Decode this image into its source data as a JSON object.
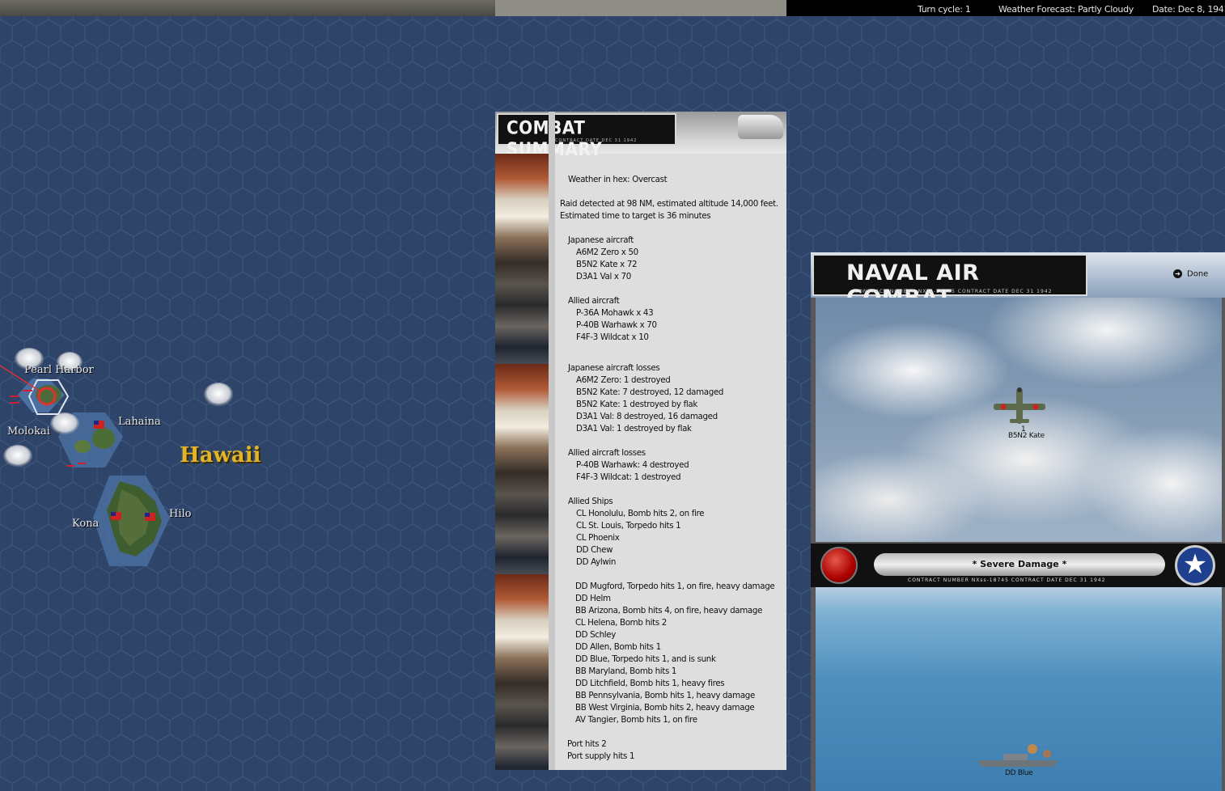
{
  "status": {
    "turn_cycle": "Turn cycle: 1",
    "weather": "Weather Forecast: Partly Cloudy",
    "date": "Date: Dec 8, 1941"
  },
  "map": {
    "region_label": "Hawaii",
    "places": [
      "Pearl Harbor",
      "Molokai",
      "Lahaina",
      "Kona",
      "Hilo"
    ]
  },
  "combat_summary": {
    "title": "COMBAT SUMMARY",
    "contract": "CONTRACT DATE DEC 31 1942",
    "lines": [
      "Weather in hex: Overcast",
      "Raid detected at 98 NM, estimated altitude 14,000 feet.",
      "Estimated time to target is 36 minutes",
      "Japanese aircraft",
      "A6M2 Zero x 50",
      "B5N2 Kate x 72",
      "D3A1 Val x 70",
      "Allied aircraft",
      "P-36A Mohawk x 43",
      "P-40B Warhawk x 70",
      "F4F-3 Wildcat x 10",
      "Japanese aircraft losses",
      "A6M2 Zero: 1 destroyed",
      "B5N2 Kate: 7 destroyed, 12 damaged",
      "B5N2 Kate: 1 destroyed by flak",
      "D3A1 Val: 8 destroyed, 16 damaged",
      "D3A1 Val: 1 destroyed by flak",
      "Allied aircraft losses",
      "P-40B Warhawk: 4 destroyed",
      "F4F-3 Wildcat: 1 destroyed",
      "Allied Ships",
      "CL Honolulu, Bomb hits 2,  on fire",
      "CL St. Louis, Torpedo hits 1",
      "CL Phoenix",
      "DD Chew",
      "DD Aylwin",
      "DD Mugford, Torpedo hits 1,  on fire,  heavy damage",
      "DD Helm",
      "BB Arizona, Bomb hits 4,  on fire,  heavy damage",
      "CL Helena, Bomb hits 2",
      "DD Schley",
      "DD Allen, Bomb hits 1",
      "DD Blue, Torpedo hits 1,  and is sunk",
      "BB Maryland, Bomb hits 1",
      "DD Litchfield, Bomb hits 1,  heavy fires",
      "BB Pennsylvania, Bomb hits 1,  heavy damage",
      "BB West Virginia, Bomb hits 2,  heavy damage",
      "AV Tangier, Bomb hits 1,  on fire",
      "Port hits 2",
      "Port supply hits 1"
    ]
  },
  "naval_air_combat": {
    "title": "NAVAL AIR COMBAT",
    "contract": "CONTRACT NUMBER  NXss-18745          CONTRACT DATE DEC 31 1942",
    "done_label": "Done",
    "plane_count": "1",
    "plane_label": "B5N2 Kate",
    "damage_text": "* Severe Damage *",
    "ship_label": "DD Blue"
  }
}
